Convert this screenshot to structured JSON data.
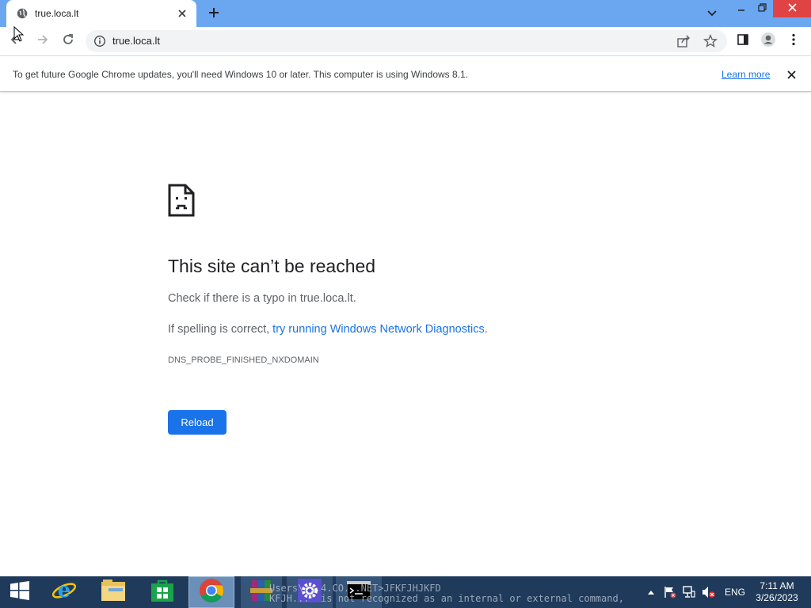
{
  "browser": {
    "tab": {
      "title": "true.loca.lt"
    },
    "address_bar": {
      "url": "true.loca.lt"
    }
  },
  "infobar": {
    "message": "To get future Google Chrome updates, you'll need Windows 10 or later. This computer is using Windows 8.1.",
    "link": "Learn more"
  },
  "error_page": {
    "title": "This site can’t be reached",
    "line1": "Check if there is a typo in true.loca.lt.",
    "line2_prefix": "If spelling is correct, ",
    "line2_link": "try running Windows Network Diagnostics",
    "line2_suffix": ".",
    "error_code": "DNS_PROBE_FINISHED_NXDOMAIN",
    "reload_label": "Reload"
  },
  "taskbar": {
    "console_line1": "Users\\...4.CO...NET>JFKFJHJKFD",
    "console_line2": "KFJH...' is not recognized as an internal or external command,",
    "language": "ENG",
    "time": "7:11 AM",
    "date": "3/26/2023"
  },
  "colors": {
    "tab_strip": "#6ba6f0",
    "accent": "#1a73e8",
    "taskbar": "#1f3a5a",
    "close_button": "#e04343"
  },
  "icons": [
    "globe-icon",
    "close-icon",
    "plus-icon",
    "chevron-down-icon",
    "minimize-icon",
    "restore-icon",
    "back-icon",
    "forward-icon",
    "reload-icon",
    "info-icon",
    "share-icon",
    "star-icon",
    "side-panel-icon",
    "profile-icon",
    "more-icon",
    "sad-page-icon",
    "windows-start-icon",
    "internet-explorer-icon",
    "file-explorer-icon",
    "store-icon",
    "chrome-icon",
    "winrar-icon",
    "settings-icon",
    "cmd-icon",
    "flag-icon",
    "network-icon",
    "volume-muted-icon"
  ]
}
